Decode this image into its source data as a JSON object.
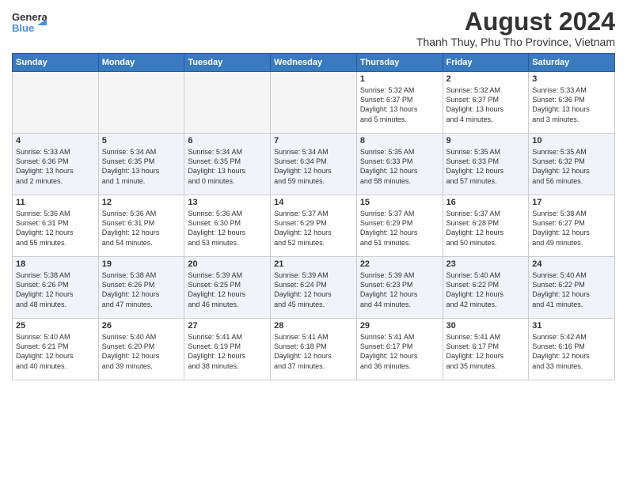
{
  "logo": {
    "line1": "General",
    "line2": "Blue"
  },
  "title": "August 2024",
  "location": "Thanh Thuy, Phu Tho Province, Vietnam",
  "headers": [
    "Sunday",
    "Monday",
    "Tuesday",
    "Wednesday",
    "Thursday",
    "Friday",
    "Saturday"
  ],
  "weeks": [
    [
      {
        "day": "",
        "content": ""
      },
      {
        "day": "",
        "content": ""
      },
      {
        "day": "",
        "content": ""
      },
      {
        "day": "",
        "content": ""
      },
      {
        "day": "1",
        "content": "Sunrise: 5:32 AM\nSunset: 6:37 PM\nDaylight: 13 hours\nand 5 minutes."
      },
      {
        "day": "2",
        "content": "Sunrise: 5:32 AM\nSunset: 6:37 PM\nDaylight: 13 hours\nand 4 minutes."
      },
      {
        "day": "3",
        "content": "Sunrise: 5:33 AM\nSunset: 6:36 PM\nDaylight: 13 hours\nand 3 minutes."
      }
    ],
    [
      {
        "day": "4",
        "content": "Sunrise: 5:33 AM\nSunset: 6:36 PM\nDaylight: 13 hours\nand 2 minutes."
      },
      {
        "day": "5",
        "content": "Sunrise: 5:34 AM\nSunset: 6:35 PM\nDaylight: 13 hours\nand 1 minute."
      },
      {
        "day": "6",
        "content": "Sunrise: 5:34 AM\nSunset: 6:35 PM\nDaylight: 13 hours\nand 0 minutes."
      },
      {
        "day": "7",
        "content": "Sunrise: 5:34 AM\nSunset: 6:34 PM\nDaylight: 12 hours\nand 59 minutes."
      },
      {
        "day": "8",
        "content": "Sunrise: 5:35 AM\nSunset: 6:33 PM\nDaylight: 12 hours\nand 58 minutes."
      },
      {
        "day": "9",
        "content": "Sunrise: 5:35 AM\nSunset: 6:33 PM\nDaylight: 12 hours\nand 57 minutes."
      },
      {
        "day": "10",
        "content": "Sunrise: 5:35 AM\nSunset: 6:32 PM\nDaylight: 12 hours\nand 56 minutes."
      }
    ],
    [
      {
        "day": "11",
        "content": "Sunrise: 5:36 AM\nSunset: 6:31 PM\nDaylight: 12 hours\nand 55 minutes."
      },
      {
        "day": "12",
        "content": "Sunrise: 5:36 AM\nSunset: 6:31 PM\nDaylight: 12 hours\nand 54 minutes."
      },
      {
        "day": "13",
        "content": "Sunrise: 5:36 AM\nSunset: 6:30 PM\nDaylight: 12 hours\nand 53 minutes."
      },
      {
        "day": "14",
        "content": "Sunrise: 5:37 AM\nSunset: 6:29 PM\nDaylight: 12 hours\nand 52 minutes."
      },
      {
        "day": "15",
        "content": "Sunrise: 5:37 AM\nSunset: 6:29 PM\nDaylight: 12 hours\nand 51 minutes."
      },
      {
        "day": "16",
        "content": "Sunrise: 5:37 AM\nSunset: 6:28 PM\nDaylight: 12 hours\nand 50 minutes."
      },
      {
        "day": "17",
        "content": "Sunrise: 5:38 AM\nSunset: 6:27 PM\nDaylight: 12 hours\nand 49 minutes."
      }
    ],
    [
      {
        "day": "18",
        "content": "Sunrise: 5:38 AM\nSunset: 6:26 PM\nDaylight: 12 hours\nand 48 minutes."
      },
      {
        "day": "19",
        "content": "Sunrise: 5:38 AM\nSunset: 6:26 PM\nDaylight: 12 hours\nand 47 minutes."
      },
      {
        "day": "20",
        "content": "Sunrise: 5:39 AM\nSunset: 6:25 PM\nDaylight: 12 hours\nand 46 minutes."
      },
      {
        "day": "21",
        "content": "Sunrise: 5:39 AM\nSunset: 6:24 PM\nDaylight: 12 hours\nand 45 minutes."
      },
      {
        "day": "22",
        "content": "Sunrise: 5:39 AM\nSunset: 6:23 PM\nDaylight: 12 hours\nand 44 minutes."
      },
      {
        "day": "23",
        "content": "Sunrise: 5:40 AM\nSunset: 6:22 PM\nDaylight: 12 hours\nand 42 minutes."
      },
      {
        "day": "24",
        "content": "Sunrise: 5:40 AM\nSunset: 6:22 PM\nDaylight: 12 hours\nand 41 minutes."
      }
    ],
    [
      {
        "day": "25",
        "content": "Sunrise: 5:40 AM\nSunset: 6:21 PM\nDaylight: 12 hours\nand 40 minutes."
      },
      {
        "day": "26",
        "content": "Sunrise: 5:40 AM\nSunset: 6:20 PM\nDaylight: 12 hours\nand 39 minutes."
      },
      {
        "day": "27",
        "content": "Sunrise: 5:41 AM\nSunset: 6:19 PM\nDaylight: 12 hours\nand 38 minutes."
      },
      {
        "day": "28",
        "content": "Sunrise: 5:41 AM\nSunset: 6:18 PM\nDaylight: 12 hours\nand 37 minutes."
      },
      {
        "day": "29",
        "content": "Sunrise: 5:41 AM\nSunset: 6:17 PM\nDaylight: 12 hours\nand 36 minutes."
      },
      {
        "day": "30",
        "content": "Sunrise: 5:41 AM\nSunset: 6:17 PM\nDaylight: 12 hours\nand 35 minutes."
      },
      {
        "day": "31",
        "content": "Sunrise: 5:42 AM\nSunset: 6:16 PM\nDaylight: 12 hours\nand 33 minutes."
      }
    ]
  ]
}
